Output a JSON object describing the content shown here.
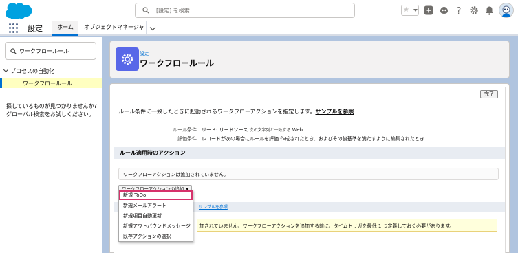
{
  "header": {
    "search_placeholder": "[設定] を検索",
    "icons": [
      "favorites-star-icon",
      "favorites-dropdown-icon",
      "add-icon",
      "trailhead-icon",
      "help-icon",
      "settings-gear-icon",
      "notifications-bell-icon",
      "avatar"
    ]
  },
  "nav": {
    "app_name": "設定",
    "tabs": [
      {
        "label": "ホーム",
        "active": true
      },
      {
        "label": "オブジェクトマネージャ",
        "active": false
      }
    ]
  },
  "sidebar": {
    "quick_find_value": "ワークフロールール",
    "tree_parent": "プロセスの自動化",
    "tree_child": "ワークフロールール",
    "not_found_text": "探しているものが見つかりませんか? グローバル検索をお試しください。"
  },
  "page_header": {
    "breadcrumb": "設定",
    "title": "ワークフロールール"
  },
  "content": {
    "done_label": "完了",
    "description": "ルール条件に一致したときに起動されるワークフローアクションを指定します。",
    "sample_link": "サンプルを参照",
    "rule_criteria_label": "ルール条件",
    "rule_criteria_value": "リード: リードソース",
    "rule_criteria_op": "次の文字列と一致する",
    "rule_criteria_val2": "Web",
    "eval_label": "評価条件",
    "eval_value": "レコードが次の場合にルールを評価 作成されたとき、およびその後基準を満たすように編集されたとき",
    "section1_title": "ルール適用時のアクション",
    "no_actions_text": "ワークフローアクションは追加されていません。",
    "add_action_label": "ワークフローアクションの追加",
    "section2_link": "サンプルを参照",
    "warning_text": "加されていません。ワークフローアクションを追加する前に、タイムトリガを最低 1 つ定義しておく必要があります。"
  },
  "menu": {
    "items": [
      "新規 ToDo",
      "新規メールアラート",
      "新規項目自動更新",
      "新規アウトバウンドメッセージ",
      "既存アクションの選択"
    ],
    "highlighted_index": 0
  },
  "colors": {
    "brand_blue": "#0070d2",
    "setup_icon_bg": "#5867e8",
    "highlight": "#d6336c",
    "warning_bg": "#ffffdc",
    "selected_bg": "#ffffc0"
  }
}
